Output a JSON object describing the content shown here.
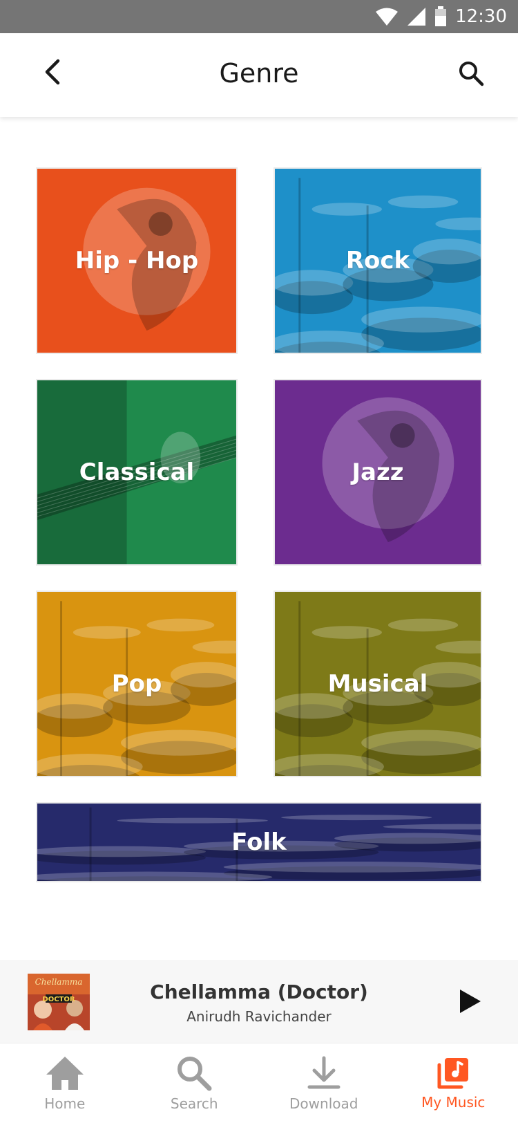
{
  "status_bar": {
    "time": "12:30"
  },
  "header": {
    "title": "Genre",
    "back_icon": "back-arrow-icon",
    "search_icon": "search-icon"
  },
  "genres": [
    {
      "label": "Hip - Hop",
      "color": "#E8501C",
      "image": "dancer"
    },
    {
      "label": "Rock",
      "color": "#1E90C9",
      "image": "drums"
    },
    {
      "label": "Classical",
      "color": "#1F8A4C",
      "image": "guitar"
    },
    {
      "label": "Jazz",
      "color": "#6C2C8F",
      "image": "dancer"
    },
    {
      "label": "Pop",
      "color": "#D99410",
      "image": "drums"
    },
    {
      "label": "Musical",
      "color": "#7E7A18",
      "image": "drums"
    },
    {
      "label": "Folk",
      "color": "#262A6B",
      "image": "drums"
    }
  ],
  "now_playing": {
    "title": "Chellamma (Doctor)",
    "artist": "Anirudh Ravichander",
    "album_art_text_1": "Chellamma",
    "album_art_text_2": "DOCTOR",
    "play_icon": "play-icon"
  },
  "bottom_nav": [
    {
      "label": "Home",
      "icon": "home-icon",
      "active": false
    },
    {
      "label": "Search",
      "icon": "search-icon",
      "active": false
    },
    {
      "label": "Download",
      "icon": "download-icon",
      "active": false
    },
    {
      "label": "My Music",
      "icon": "music-library-icon",
      "active": true
    }
  ],
  "colors": {
    "accent": "#FF5722",
    "inactive_nav": "#9E9E9E",
    "status_bar": "#757575"
  }
}
